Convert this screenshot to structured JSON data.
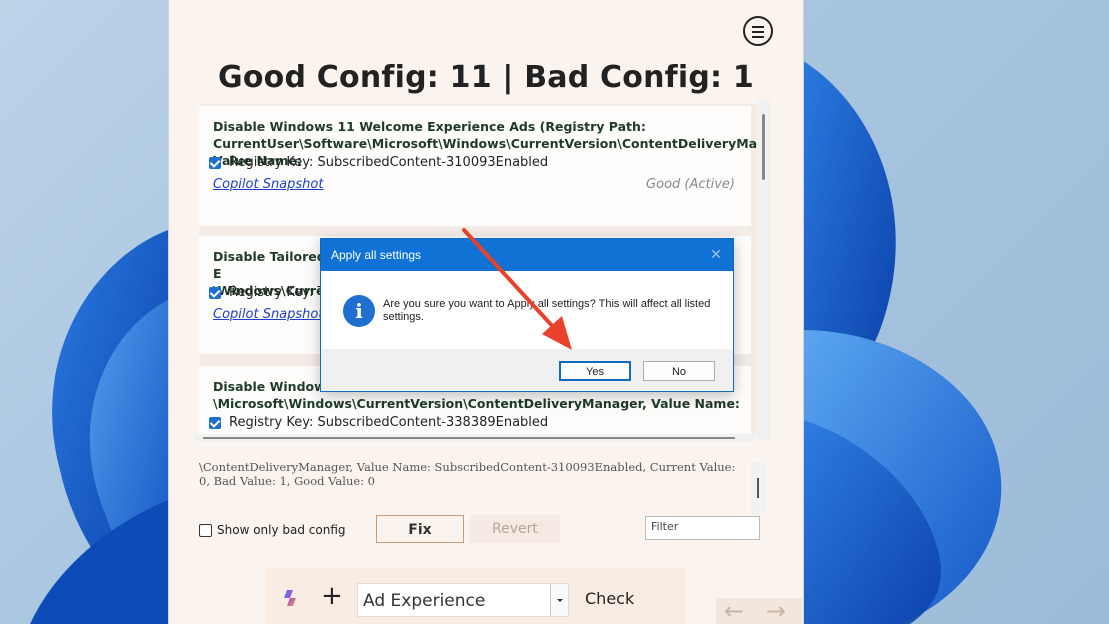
{
  "app": {
    "title": "Good Config: 11 | Bad Config: 1",
    "menu_icon": "hamburger-menu-icon"
  },
  "list": {
    "items": [
      {
        "title": "Disable Windows 11 Welcome Experience Ads (Registry Path: CurrentUser\\Software\\Microsoft\\Windows\\CurrentVersion\\ContentDeliveryManager, Value Name:",
        "key": "Registry Key: SubscribedContent-310093Enabled",
        "link": "Copilot Snapshot",
        "status": "Good (Active)"
      },
      {
        "title": "Disable Tailored E",
        "title_line2": "\\Windows\\Curren",
        "key": "Registry Key: Ta",
        "link": "Copilot Snapshot",
        "status": ")"
      },
      {
        "title": "Disable Windows",
        "title_line2": "\\Microsoft\\Windows\\CurrentVersion\\ContentDeliveryManager, Value Name:",
        "key": "Registry Key: SubscribedContent-338389Enabled"
      }
    ]
  },
  "details": {
    "text": "\\ContentDeliveryManager, Value Name: SubscribedContent-310093Enabled, Current Value: 0, Bad Value: 1, Good Value: 0"
  },
  "controls": {
    "show_bad_label": "Show only bad config",
    "fix_label": "Fix",
    "revert_label": "Revert",
    "filter_placeholder": "Filter"
  },
  "bottom": {
    "combo_value": "Ad Experience",
    "check_label": "Check",
    "plus": "+",
    "back_arrow": "←",
    "forward_arrow": "→"
  },
  "dialog": {
    "title": "Apply all settings",
    "close": "✕",
    "info_glyph": "i",
    "message": "Are you sure you want to Apply all settings? This will affect all listed settings.",
    "yes_label": "Yes",
    "no_label": "No"
  },
  "colors": {
    "accent": "#0f72d4",
    "app_bg": "#fbf3ee",
    "annotation_arrow": "#e8412c"
  }
}
